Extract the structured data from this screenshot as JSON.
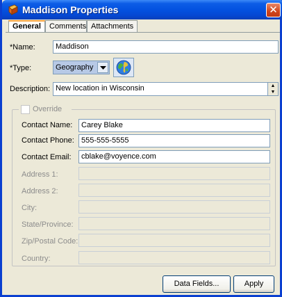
{
  "window": {
    "title": "Maddison Properties"
  },
  "tabs": [
    {
      "label": "General"
    },
    {
      "label": "Comments"
    },
    {
      "label": "Attachments"
    }
  ],
  "form": {
    "name_label": "*Name:",
    "name_value": "Maddison",
    "type_label": "*Type:",
    "type_value": "Geography",
    "description_label": "Description:",
    "description_value": "New location in Wisconsin"
  },
  "override": {
    "label": "Override",
    "checked": false,
    "fields": [
      {
        "label": "Contact Name:",
        "value": "Carey Blake",
        "enabled": true
      },
      {
        "label": "Contact Phone:",
        "value": "555-555-5555",
        "enabled": true
      },
      {
        "label": "Contact Email:",
        "value": "cblake@voyence.com",
        "enabled": true
      },
      {
        "label": "Address 1:",
        "value": "",
        "enabled": false
      },
      {
        "label": "Address 2:",
        "value": "",
        "enabled": false
      },
      {
        "label": "City:",
        "value": "",
        "enabled": false
      },
      {
        "label": "State/Province:",
        "value": "",
        "enabled": false
      },
      {
        "label": "Zip/Postal Code:",
        "value": "",
        "enabled": false
      },
      {
        "label": "Country:",
        "value": "",
        "enabled": false
      }
    ]
  },
  "buttons": {
    "data_fields": "Data Fields...",
    "apply": "Apply"
  },
  "icons": {
    "app": "properties-app-icon",
    "close": "close-icon",
    "globe": "globe-icon",
    "dropdown": "chevron-down-icon"
  },
  "colors": {
    "titlebar": "#0452e0",
    "close": "#d0451b",
    "active_tab_accent": "#f5a340",
    "field_border": "#7f9db9"
  }
}
